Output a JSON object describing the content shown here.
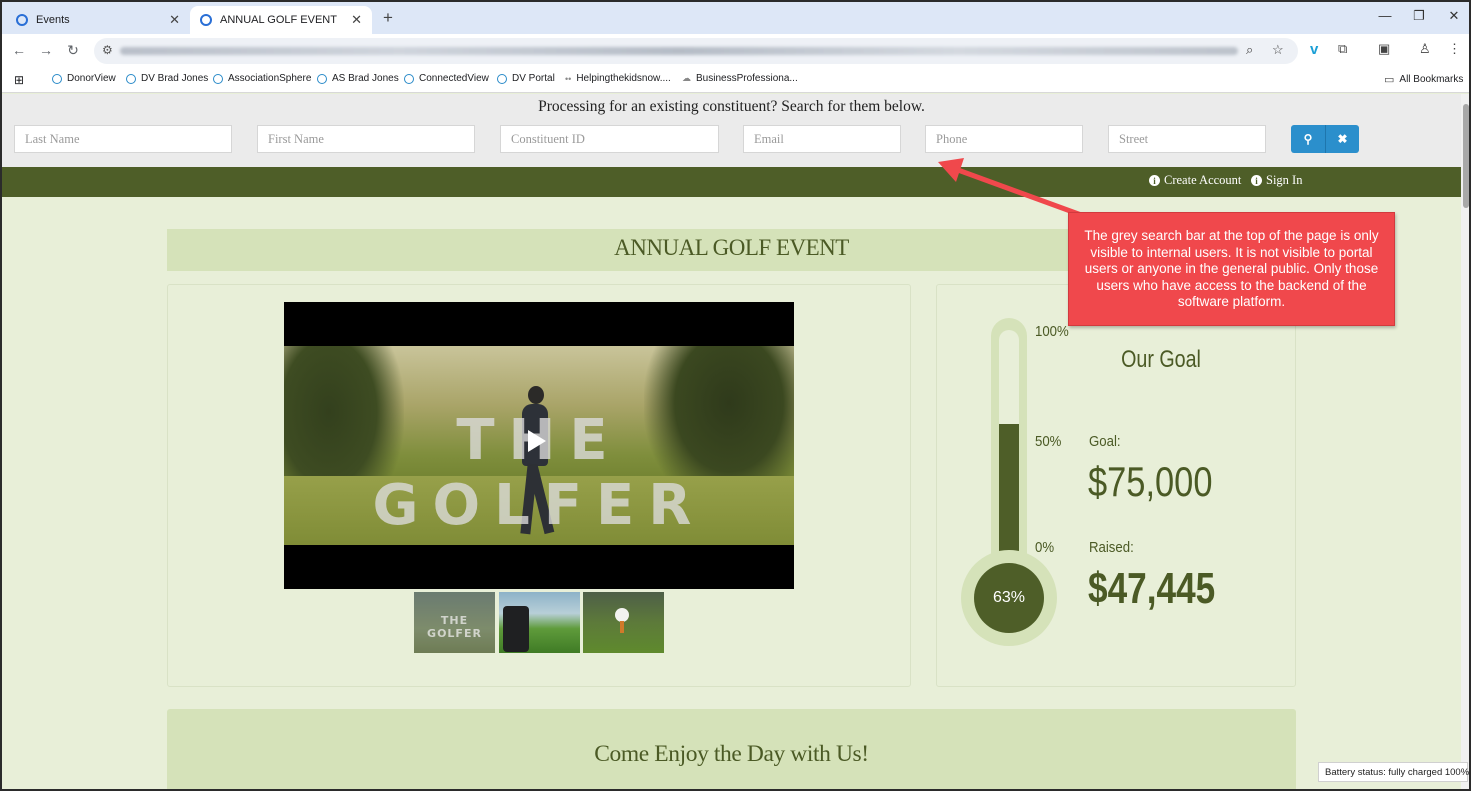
{
  "browser": {
    "tabs": [
      {
        "title": "Events"
      },
      {
        "title": "ANNUAL GOLF EVENT"
      }
    ],
    "bookmarks": [
      "DonorView",
      "DV Brad Jones",
      "AssociationSphere",
      "AS Brad Jones",
      "ConnectedView",
      "DV Portal",
      "Helpingthekidsnow....",
      "BusinessProfessiona..."
    ],
    "all_bookmarks": "All Bookmarks"
  },
  "search": {
    "prompt": "Processing for an existing constituent? Search for them below.",
    "placeholders": {
      "last_name": "Last Name",
      "first_name": "First Name",
      "constituent_id": "Constituent ID",
      "email": "Email",
      "phone": "Phone",
      "street": "Street"
    }
  },
  "account": {
    "create": "Create Account",
    "sign_in": "Sign In"
  },
  "event": {
    "title": "ANNUAL GOLF EVENT",
    "video_title": "THE GOLFER",
    "thumb1_text": "THE GOLFER"
  },
  "goal": {
    "heading": "Our Goal",
    "tick_100": "100%",
    "tick_50": "50%",
    "tick_0": "0%",
    "percent_label": "63%",
    "percent_value": 0.63,
    "goal_label": "Goal:",
    "goal_value": "$75,000",
    "raised_label": "Raised:",
    "raised_value": "$47,445"
  },
  "section": {
    "title": "Come Enjoy the Day with Us!"
  },
  "annotation": {
    "text": "The grey search bar at the top of the page is only visible to internal users. It is not visible to portal users or anyone in the general public. Only those users who have access to the backend of the software platform."
  },
  "status": {
    "battery": "Battery status: fully charged 100%"
  },
  "colors": {
    "brand_green": "#4e5e28",
    "light_green": "#d5e2b9",
    "page_bg": "#e8efd8",
    "search_button": "#2b8fcc",
    "callout_red": "#f0484c"
  }
}
